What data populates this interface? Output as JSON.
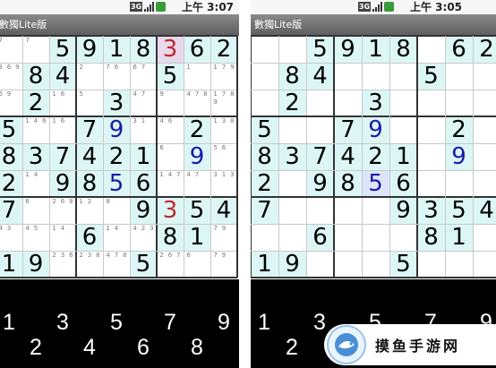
{
  "left_phone": {
    "status": {
      "network_label": "3G",
      "time": "上午 3:07"
    },
    "app_title": "數獨Lite版",
    "board": [
      [
        "",
        "",
        "5",
        "9",
        "1",
        "8",
        "3",
        "6",
        "2"
      ],
      [
        "",
        "8",
        "4",
        "",
        "",
        "",
        "5",
        "",
        ""
      ],
      [
        "",
        "2",
        "",
        "",
        "3",
        "",
        "",
        "",
        ""
      ],
      [
        "5",
        "",
        "",
        "7",
        "9",
        "",
        "",
        "2",
        ""
      ],
      [
        "8",
        "3",
        "7",
        "4",
        "2",
        "1",
        "",
        "9",
        ""
      ],
      [
        "2",
        "",
        "9",
        "8",
        "5",
        "6",
        "",
        "",
        ""
      ],
      [
        "7",
        "",
        "",
        "",
        "",
        "9",
        "3",
        "5",
        "4"
      ],
      [
        "",
        "",
        "",
        "6",
        "",
        "",
        "8",
        "1",
        ""
      ],
      [
        "1",
        "9",
        "",
        "",
        "",
        "5",
        "",
        "",
        ""
      ]
    ],
    "pencil_marks": [
      [
        [
          "7"
        ],
        [
          "7"
        ],
        [],
        [],
        [],
        [],
        [],
        [],
        []
      ],
      [
        [
          "3",
          "6",
          "9"
        ],
        [],
        [],
        [
          "2"
        ],
        [
          "7",
          "6"
        ],
        [
          "6",
          "7"
        ],
        [],
        [
          "1"
        ],
        [
          "1",
          "7",
          "9"
        ]
      ],
      [
        [
          "6",
          "9"
        ],
        [],
        [
          "1",
          "6"
        ],
        [
          "5"
        ],
        [],
        [
          "4",
          "7"
        ],
        [
          "9"
        ],
        [
          "4",
          "7",
          "8"
        ],
        [
          "1",
          "7",
          "8",
          "9"
        ]
      ],
      [
        [],
        [
          "1",
          "4",
          "6"
        ],
        [
          "1",
          "6"
        ],
        [],
        [],
        [
          "3",
          "1"
        ],
        [
          "4",
          "6"
        ],
        [],
        [
          "1",
          "3",
          "8"
        ]
      ],
      [
        [],
        [],
        [],
        [],
        [],
        [],
        [
          "6"
        ],
        [],
        [
          "5",
          "6"
        ]
      ],
      [
        [],
        [
          "1",
          "4"
        ],
        [],
        [],
        [],
        [],
        [
          "1",
          "4",
          "7"
        ],
        [
          "4",
          "7"
        ],
        [
          "3",
          "1",
          "3"
        ]
      ],
      [
        [],
        [
          "6"
        ],
        [
          "2",
          "6",
          "8"
        ],
        [
          "1",
          "2"
        ],
        [
          "8"
        ],
        [],
        [],
        [],
        []
      ],
      [
        [
          "4",
          "3"
        ],
        [
          "4",
          "5"
        ],
        [
          "1",
          "4"
        ],
        [],
        [
          "1",
          "4"
        ],
        [
          "4",
          "2",
          "3"
        ],
        [],
        [],
        [
          "7",
          "9"
        ]
      ],
      [
        [],
        [],
        [
          "2",
          "3",
          "6"
        ],
        [
          "2",
          "3",
          "8"
        ],
        [
          "4",
          "7",
          "8"
        ],
        [],
        [
          "2",
          "6",
          "7"
        ],
        [
          "6"
        ],
        [
          "7",
          "9"
        ]
      ]
    ],
    "keypad_top": [
      "1",
      "3",
      "5",
      "7",
      "9"
    ],
    "keypad_bottom": [
      "2",
      "4",
      "6",
      "8"
    ]
  },
  "right_phone": {
    "status": {
      "network_label": "3G",
      "time": "上午 3:05"
    },
    "app_title": "數獨Lite版",
    "board": [
      [
        "",
        "",
        "5",
        "9",
        "1",
        "8",
        "",
        "6",
        "2"
      ],
      [
        "",
        "8",
        "4",
        "",
        "",
        "",
        "5",
        "",
        ""
      ],
      [
        "",
        "2",
        "",
        "",
        "3",
        "",
        "",
        "",
        ""
      ],
      [
        "5",
        "",
        "",
        "7",
        "9",
        "",
        "",
        "2",
        ""
      ],
      [
        "8",
        "3",
        "7",
        "4",
        "2",
        "1",
        "",
        "9",
        ""
      ],
      [
        "2",
        "",
        "9",
        "8",
        "5",
        "6",
        "",
        "",
        ""
      ],
      [
        "7",
        "",
        "",
        "",
        "",
        "9",
        "3",
        "5",
        "4"
      ],
      [
        "",
        "",
        "6",
        "",
        "",
        "",
        "8",
        "1",
        ""
      ],
      [
        "1",
        "9",
        "",
        "",
        "",
        "5",
        "",
        "",
        ""
      ]
    ],
    "keypad_top": [
      "1",
      "3",
      "5",
      "7",
      "9"
    ],
    "keypad_bottom": [
      "2"
    ]
  },
  "watermark": {
    "text": "摸鱼手游网"
  },
  "colors": {
    "highlight": "#dcf6f6",
    "given_digit": "#000000",
    "user_digit": "#1a1aa8",
    "conflict_digit": "#c0282a",
    "selected_cell": "#e8d8ec",
    "titlebar": "#6e6e6e"
  }
}
